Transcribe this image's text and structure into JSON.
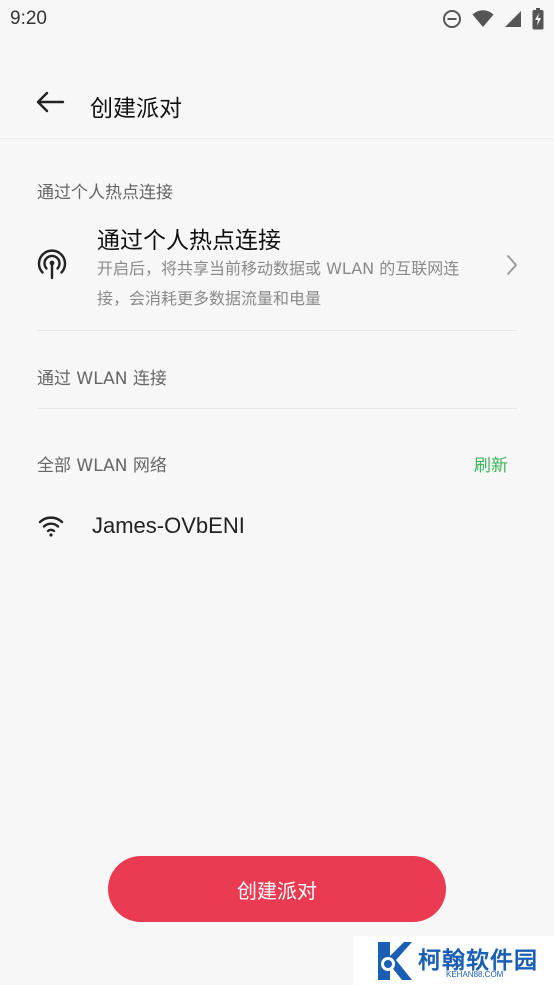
{
  "status_bar": {
    "time": "9:20",
    "icons": [
      "do-not-disturb-icon",
      "wifi-signal-icon",
      "cell-signal-icon",
      "battery-charging-icon"
    ]
  },
  "header": {
    "back_icon": "arrow-left-icon",
    "title": "创建派对"
  },
  "hotspot_section": {
    "label": "通过个人热点连接",
    "item": {
      "icon": "hotspot-icon",
      "title": "通过个人热点连接",
      "description": "开启后，将共享当前移动数据或 WLAN 的互联网连接，会消耗更多数据流量和电量"
    }
  },
  "wlan_section": {
    "label": "通过 WLAN 连接"
  },
  "networks_section": {
    "label": "全部 WLAN 网络",
    "refresh_label": "刷新",
    "networks": [
      {
        "name": "James-OVbENI",
        "icon": "wifi-icon"
      }
    ]
  },
  "footer": {
    "create_button_label": "创建派对"
  },
  "watermark": {
    "text": "柯翰软件园",
    "sub": "KEHAN88.COM"
  },
  "colors": {
    "accent": "#ea3b52",
    "refresh": "#3cb35a",
    "background": "#f7f7f7"
  }
}
